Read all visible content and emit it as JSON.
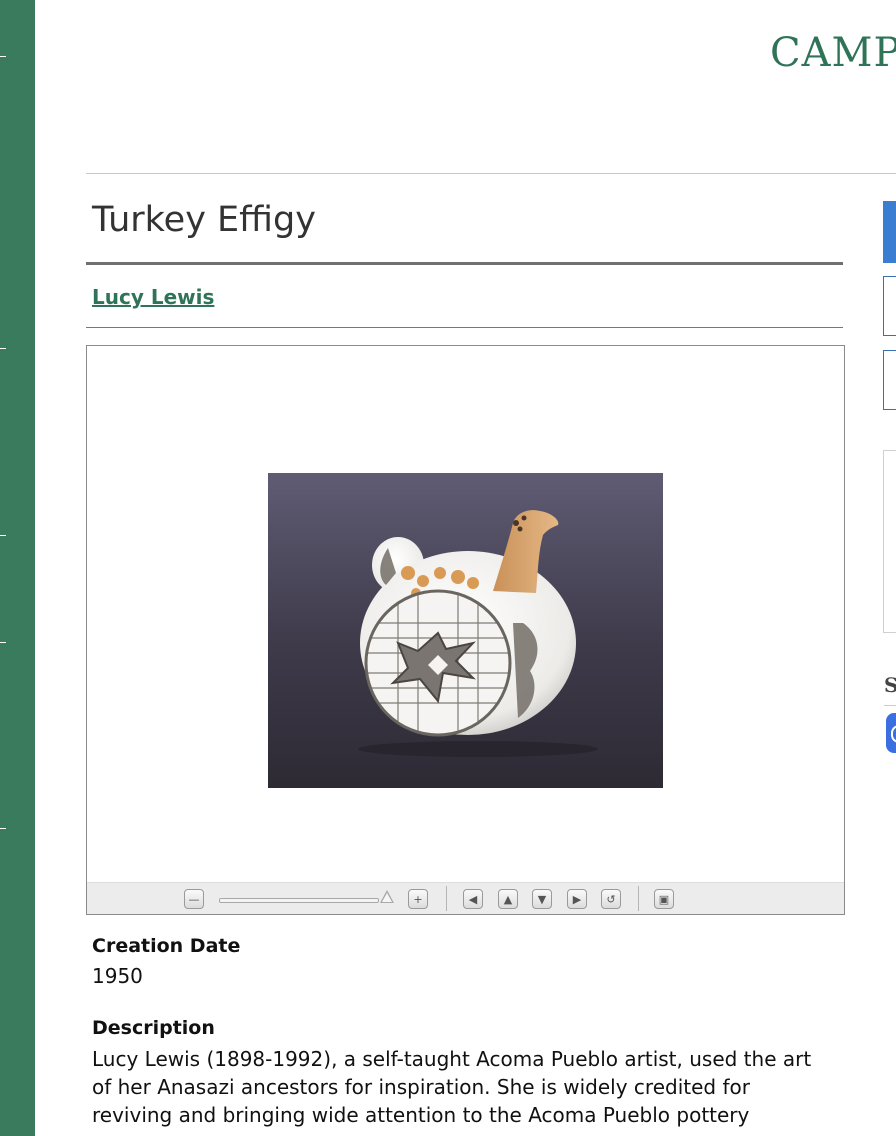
{
  "site": {
    "brand": "CAMP"
  },
  "artwork": {
    "title": "Turkey Effigy",
    "artist": "Lucy Lewis"
  },
  "viewer": {
    "toolbar": {
      "zoom_out_icon": "minus-icon",
      "zoom_in_icon": "plus-icon",
      "pan_left_icon": "arrow-left-icon",
      "pan_up_icon": "arrow-up-icon",
      "pan_down_icon": "arrow-down-icon",
      "pan_right_icon": "arrow-right-icon",
      "reset_icon": "reset-icon",
      "fullscreen_icon": "fullscreen-icon",
      "zoom_level": 1.0
    }
  },
  "fields": {
    "creation_date_label": "Creation Date",
    "creation_date_value": "1950",
    "description_label": "Description",
    "description_text": "Lucy Lewis (1898-1992), a self-taught Acoma Pueblo artist, used the art of her Anasazi ancestors for inspiration. She is widely credited for reviving and bringing wide attention to the Acoma Pueblo pottery"
  },
  "sidebar": {
    "share_heading_fragment": "S"
  },
  "colors": {
    "rail": "#3a7a5d",
    "brand": "#2f7458",
    "link": "#2f7458",
    "sidebar_button": "#3b7dd0"
  }
}
